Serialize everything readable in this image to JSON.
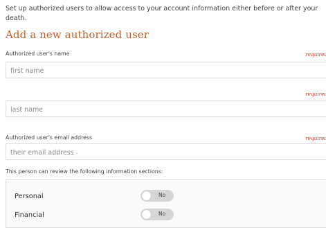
{
  "intro_text": "Set up authorized users to allow access to your account information either before or after your death.",
  "heading": "Add a new authorized user",
  "name_section": {
    "label": "Authorized user's name",
    "required_label": "required",
    "first_name_placeholder": "first name",
    "last_name_required_label": "required",
    "last_name_placeholder": "last name"
  },
  "email_section": {
    "label": "Authorized user's email address",
    "required_label": "required",
    "email_placeholder": "their email address"
  },
  "sections_intro": "This person can review the following information sections:",
  "info_sections": [
    {
      "label": "Personal",
      "toggle_text": "No",
      "enabled": false
    },
    {
      "label": "Financial",
      "toggle_text": "No",
      "enabled": false
    }
  ],
  "colors": {
    "heading": "#c0622b",
    "required": "#c0392b",
    "toggle_off": "#d6d6d6"
  }
}
